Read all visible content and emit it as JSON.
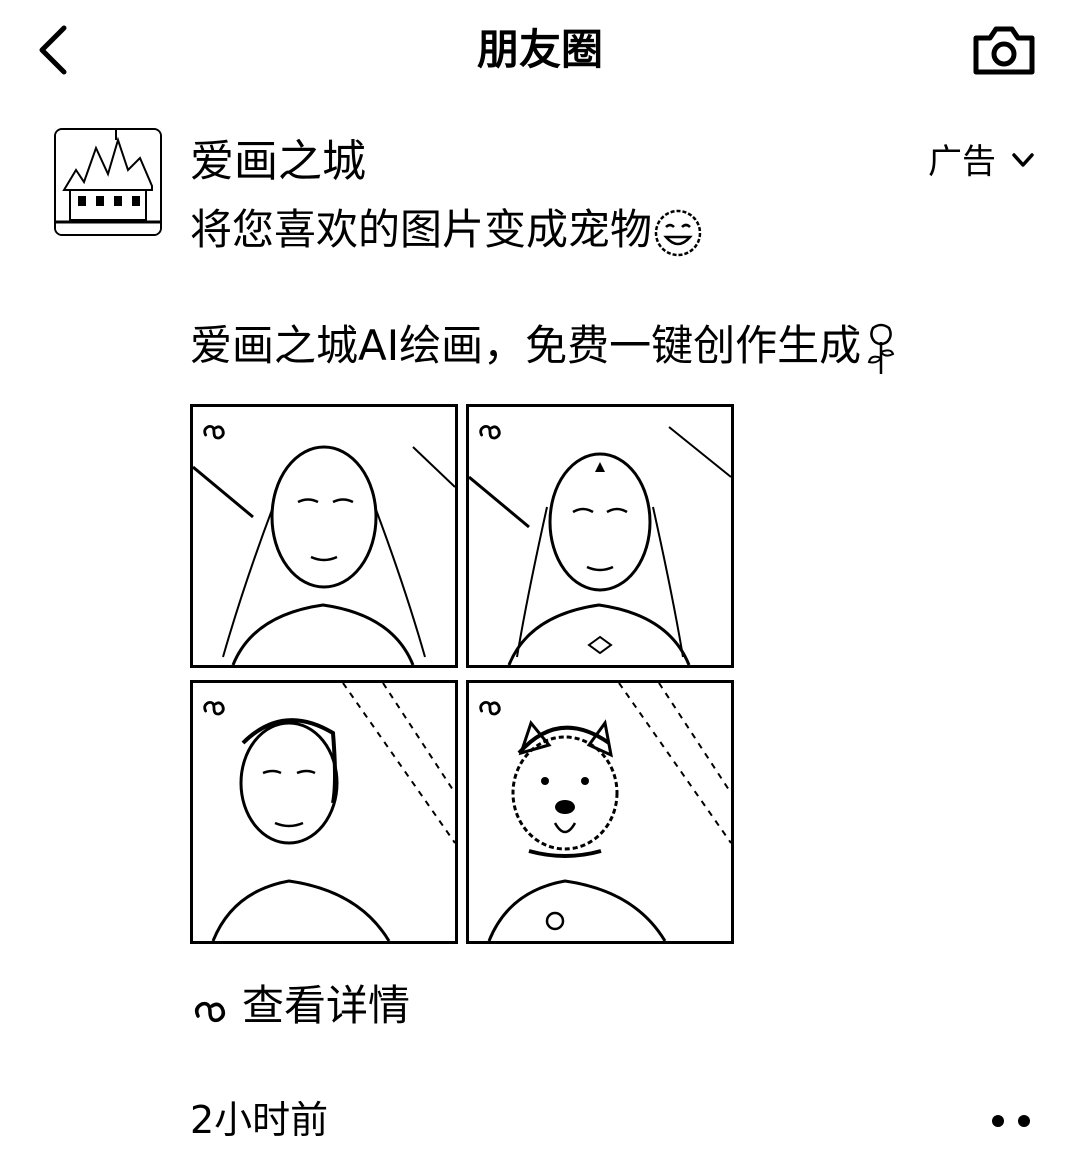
{
  "nav": {
    "title": "朋友圈"
  },
  "post": {
    "author": "爱画之城",
    "ad_label": "广告",
    "text_line1": "将您喜欢的图片变成宠物",
    "text_line2": "爱画之城AI绘画，免费一键创作生成",
    "images": [
      "woman-photo",
      "woman-anime-style",
      "man-photo",
      "dog-pet-style"
    ],
    "detail_link": "查看详情",
    "time": "2小时前"
  }
}
